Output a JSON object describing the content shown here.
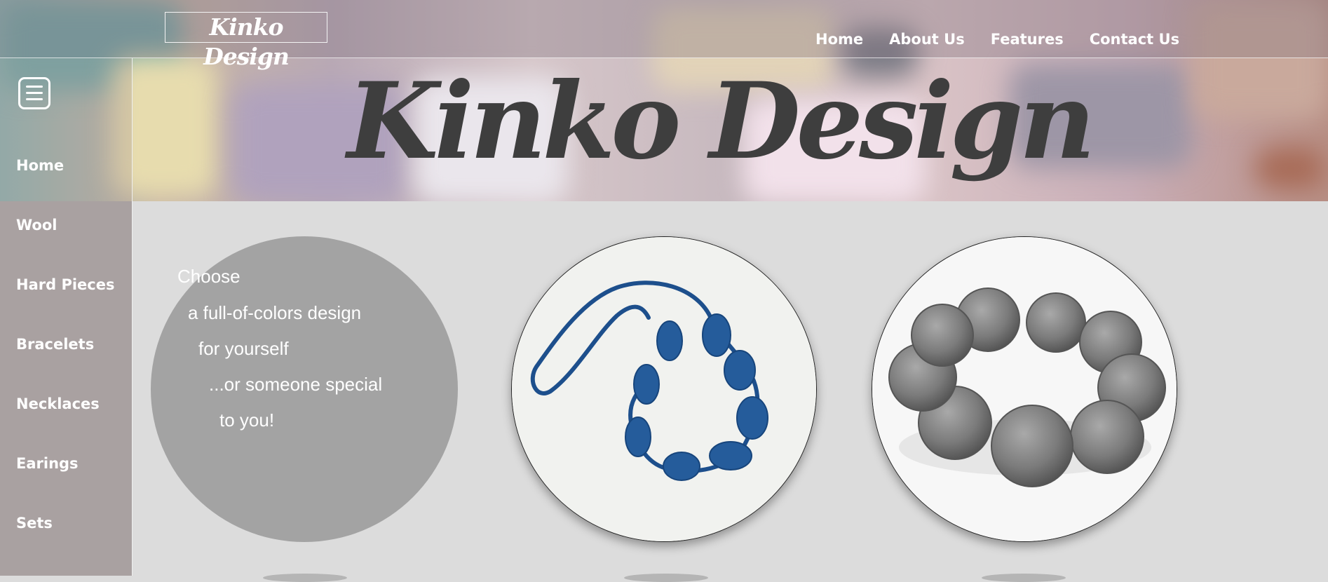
{
  "header": {
    "logo_text": "Kinko Design",
    "nav": [
      "Home",
      "About Us",
      "Features",
      "Contact Us"
    ],
    "hero_title": "Kinko Design"
  },
  "sidebar": {
    "menu_icon": "hamburger-icon",
    "items": [
      {
        "label": "Home"
      },
      {
        "label": "Wool"
      },
      {
        "label": "Hard Pieces"
      },
      {
        "label": "Bracelets"
      },
      {
        "label": "Necklaces"
      },
      {
        "label": "Earings"
      },
      {
        "label": "Sets"
      }
    ]
  },
  "intro": {
    "lines": [
      "Choose",
      "a full-of-colors design",
      "for yourself",
      "...or someone special",
      "to you!"
    ]
  },
  "products": [
    {
      "name": "blue-crochet-necklace",
      "color": "#1d4f8c"
    },
    {
      "name": "gray-crochet-bracelet",
      "color": "#7a7a7a"
    }
  ],
  "colors": {
    "page_background": "#dcdcdc",
    "sidebar_background": "#a9a1a1",
    "intro_circle": "#a3a3a3",
    "hero_title": "#3e3e3e"
  }
}
